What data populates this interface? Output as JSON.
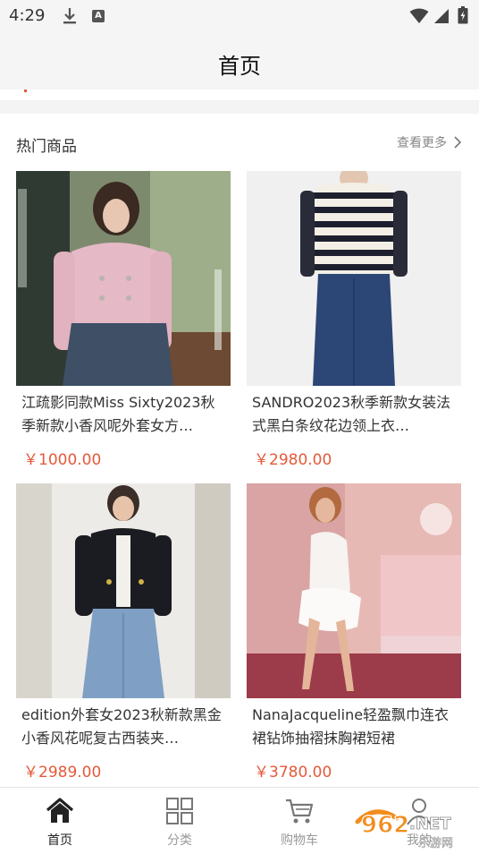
{
  "status_bar": {
    "time": "4:29"
  },
  "header": {
    "title": "首页"
  },
  "section": {
    "title": "热门商品",
    "more_label": "查看更多"
  },
  "products": [
    {
      "name": "江疏影同款Miss Sixty2023秋季新款小香风呢外套女方…",
      "price": "￥1000.00"
    },
    {
      "name": "SANDRO2023秋季新款女装法式黑白条纹花边领上衣…",
      "price": "￥2980.00"
    },
    {
      "name": "edition外套女2023秋新款黑金小香风花呢复古西装夹…",
      "price": "￥2989.00"
    },
    {
      "name": "NanaJacqueline轻盈飘巾连衣裙钻饰抽褶抹胸裙短裙",
      "price": "￥3780.00"
    }
  ],
  "tabbar": {
    "items": [
      {
        "label": "首页",
        "icon": "home-icon",
        "active": true
      },
      {
        "label": "分类",
        "icon": "grid-icon",
        "active": false
      },
      {
        "label": "购物车",
        "icon": "cart-icon",
        "active": false
      },
      {
        "label": "我的",
        "icon": "user-icon",
        "active": false
      }
    ]
  },
  "watermark": {
    "text": "962.NET",
    "subtext": "乐游网"
  },
  "colors": {
    "price": "#e45a3a",
    "accent_watermark": "#f28c1b",
    "background": "#f4f4f4"
  }
}
